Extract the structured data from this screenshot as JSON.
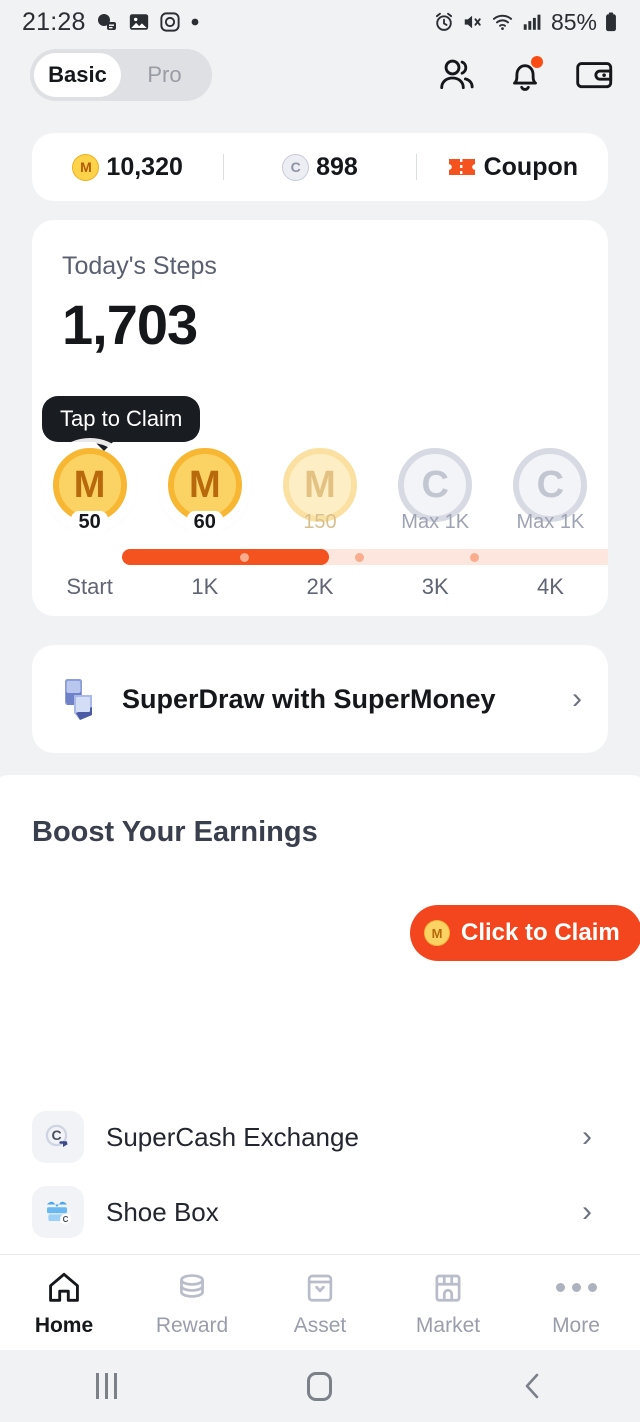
{
  "status_bar": {
    "time": "21:28",
    "battery": "85%",
    "left_icons": [
      "chat-icon",
      "gallery-icon",
      "instagram-icon",
      "dot-icon"
    ],
    "right_icons": [
      "alarm-icon",
      "mute-icon",
      "wifi-icon",
      "signal-icon",
      "battery-icon"
    ]
  },
  "header": {
    "segments": [
      {
        "label": "Basic",
        "active": true
      },
      {
        "label": "Pro",
        "active": false
      }
    ],
    "icons": [
      "friends-icon",
      "bell-icon",
      "wallet-icon"
    ],
    "bell_badge": true
  },
  "balance": {
    "money": "10,320",
    "money_symbol": "M",
    "cash": "898",
    "cash_symbol": "C",
    "coupon_label": "Coupon"
  },
  "steps": {
    "label": "Today's Steps",
    "value": "1,703",
    "tooltip": "Tap to Claim",
    "milestones": [
      {
        "symbol": "M",
        "caption": "50",
        "state": "claimable"
      },
      {
        "symbol": "M",
        "caption": "60",
        "state": "claimable"
      },
      {
        "symbol": "M",
        "caption": "150",
        "state": "locked-gold"
      },
      {
        "symbol": "C",
        "caption": "Max 1K",
        "state": "locked"
      },
      {
        "symbol": "C",
        "caption": "Max 1K",
        "state": "locked"
      }
    ],
    "ticks": [
      "Start",
      "1K",
      "2K",
      "3K",
      "4K"
    ],
    "progress_percent": 40
  },
  "superdraw": {
    "title": "SuperDraw with SuperMoney",
    "icon": "foldable-phone-icon",
    "chevron": "›"
  },
  "boost": {
    "title": "Boost Your Earnings",
    "claim_label": "Click to Claim",
    "claim_coin_symbol": "M",
    "rows": [
      {
        "label": "SuperCash Exchange",
        "icon": "supercash-exchange-icon",
        "chevron": "›"
      },
      {
        "label": "Shoe Box",
        "icon": "shoe-box-icon",
        "chevron": "›"
      }
    ]
  },
  "tabbar": {
    "items": [
      {
        "label": "Home",
        "icon": "home-icon",
        "active": true
      },
      {
        "label": "Reward",
        "icon": "coins-icon",
        "active": false
      },
      {
        "label": "Asset",
        "icon": "asset-bag-icon",
        "active": false
      },
      {
        "label": "Market",
        "icon": "market-store-icon",
        "active": false
      },
      {
        "label": "More",
        "icon": "more-dots-icon",
        "active": false
      }
    ]
  },
  "system_nav": {
    "recents": "recents-icon",
    "home": "home-square-icon",
    "back": "back-icon"
  },
  "colors": {
    "accent": "#f4461e",
    "progress_fill": "#f4531f",
    "gold": "#fbd365",
    "background": "#f1f2f4"
  }
}
